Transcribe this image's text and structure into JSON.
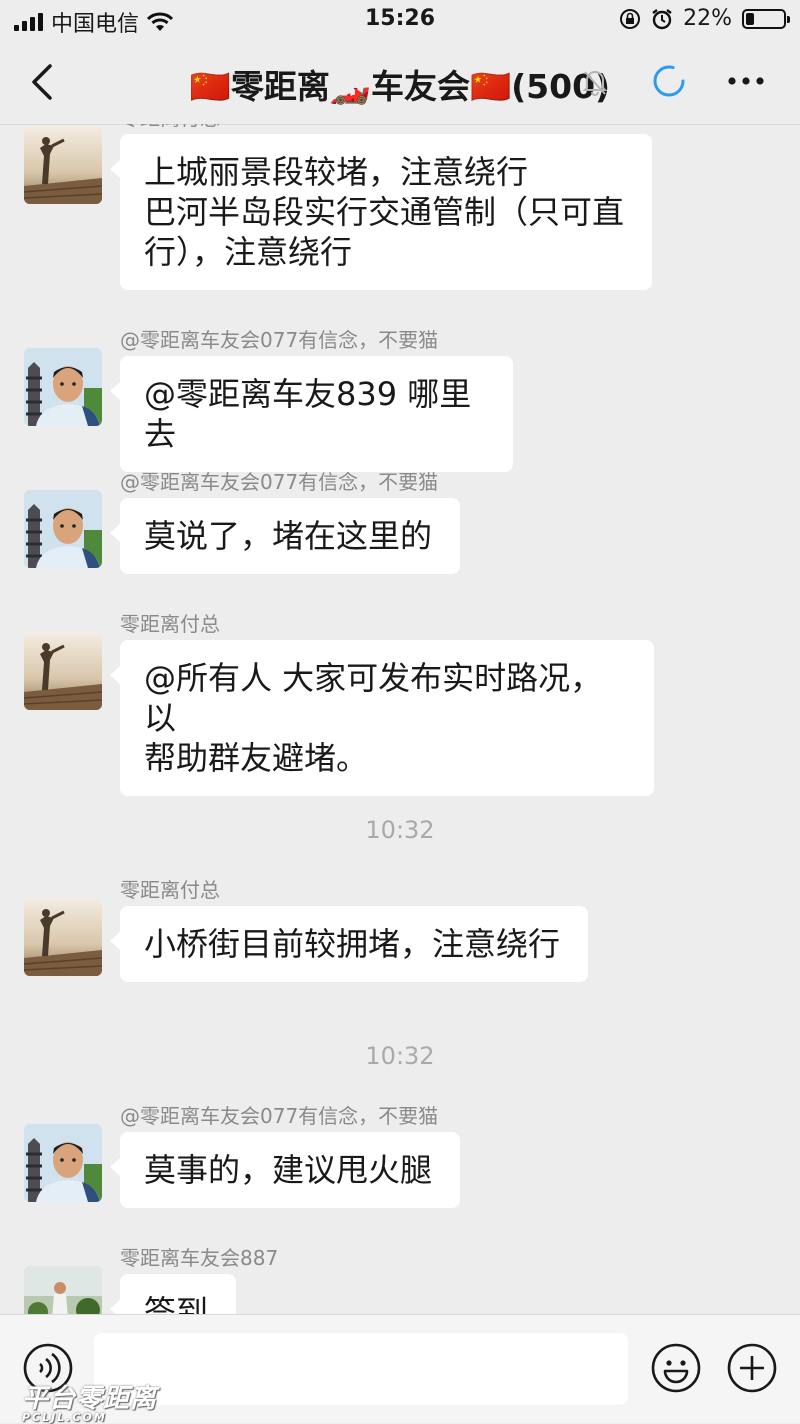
{
  "status_bar": {
    "carrier": "中国电信",
    "time": "15:26",
    "battery_text": "22%",
    "battery_level": 0.22
  },
  "header": {
    "title": "🇨🇳零距离🏎️车友会🇨🇳(500)",
    "icons": [
      "back-arrow",
      "mute-bell",
      "loading-spinner",
      "more-dots"
    ],
    "accent_color": "#2b9cf0"
  },
  "messages": [
    {
      "type": "message",
      "sender": "零距离付总",
      "avatar": "statue",
      "lines": [
        "上城丽景段较堵，注意绕行",
        "巴河半岛段实行交通管制（只可直",
        "行），注意绕行"
      ]
    },
    {
      "type": "message",
      "sender": "@零距离车友会077有信念，不要猫",
      "avatar": "man",
      "lines": [
        "@零距离车友839 哪里去"
      ]
    },
    {
      "type": "message",
      "sender": "@零距离车友会077有信念，不要猫",
      "avatar": "man",
      "lines": [
        "莫说了，堵在这里的"
      ]
    },
    {
      "type": "message",
      "sender": "零距离付总",
      "avatar": "statue",
      "lines": [
        "@所有人 大家可发布实时路况，以",
        "帮助群友避堵。"
      ]
    },
    {
      "type": "time",
      "text": "10:32"
    },
    {
      "type": "message",
      "sender": "零距离付总",
      "avatar": "statue",
      "lines": [
        "小桥街目前较拥堵，注意绕行"
      ]
    },
    {
      "type": "time",
      "text": "10:32"
    },
    {
      "type": "message",
      "sender": "@零距离车友会077有信念，不要猫",
      "avatar": "man",
      "lines": [
        "莫事的，建议甩火腿"
      ]
    },
    {
      "type": "message",
      "sender": "零距离车友会887",
      "avatar": "garden",
      "lines": [
        "签到"
      ]
    }
  ],
  "input_bar": {
    "placeholder": "",
    "icons": [
      "voice-icon",
      "emoji-icon",
      "plus-icon"
    ]
  },
  "watermark": {
    "text": "平台零距离",
    "subtext": "PCLJL.COM"
  }
}
